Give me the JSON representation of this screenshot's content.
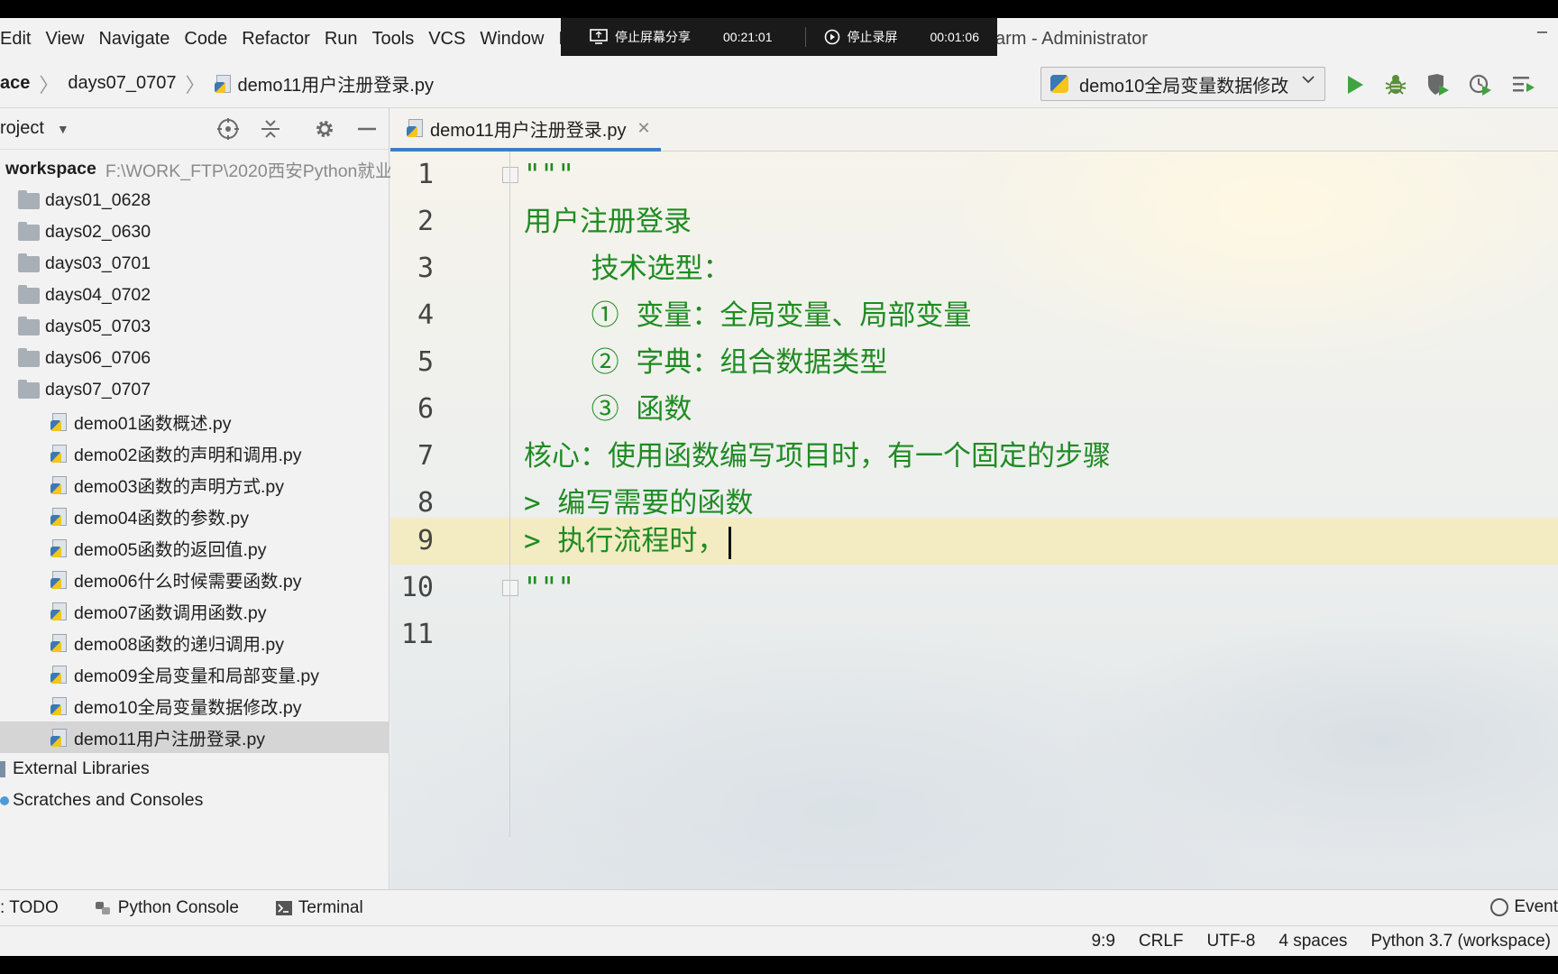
{
  "menu": [
    "Edit",
    "View",
    "Navigate",
    "Code",
    "Refactor",
    "Run",
    "Tools",
    "VCS",
    "Window",
    "H"
  ],
  "window_title": "arm - Administrator",
  "share_overlay": {
    "stop_share_label": "停止屏幕分享",
    "share_time": "00:21:01",
    "stop_record_label": "停止录屏",
    "record_time": "00:01:06"
  },
  "breadcrumb": {
    "root": "ace",
    "folder": "days07_0707",
    "file": "demo11用户注册登录.py"
  },
  "run_config": {
    "name": "demo10全局变量数据修改"
  },
  "project": {
    "title": "roject",
    "root_name": "workspace",
    "root_path": "F:\\WORK_FTP\\2020西安Python就业",
    "folders": [
      "days01_0628",
      "days02_0630",
      "days03_0701",
      "days04_0702",
      "days05_0703",
      "days06_0706",
      "days07_0707"
    ],
    "files": [
      "demo01函数概述.py",
      "demo02函数的声明和调用.py",
      "demo03函数的声明方式.py",
      "demo04函数的参数.py",
      "demo05函数的返回值.py",
      "demo06什么时候需要函数.py",
      "demo07函数调用函数.py",
      "demo08函数的递归调用.py",
      "demo09全局变量和局部变量.py",
      "demo10全局变量数据修改.py",
      "demo11用户注册登录.py"
    ],
    "external_libraries": "External Libraries",
    "scratches": "Scratches and Consoles"
  },
  "editor": {
    "tab_label": "demo11用户注册登录.py",
    "line_numbers": [
      "1",
      "2",
      "3",
      "4",
      "5",
      "6",
      "7",
      "8",
      "9",
      "10",
      "11"
    ],
    "lines": [
      "\"\"\"",
      "用户注册登录",
      "    技术选型：",
      "    ① 变量：全局变量、局部变量",
      "    ② 字典：组合数据类型",
      "    ③ 函数",
      "核心：使用函数编写项目时，有一个固定的步骤",
      "> 编写需要的函数",
      "> 执行流程时，",
      "\"\"\"",
      ""
    ],
    "current_line": 9,
    "text_color": "#1f8b22"
  },
  "bottom_tools": {
    "todo": ": TODO",
    "python_console": "Python Console",
    "terminal": "Terminal",
    "event_log": "Event"
  },
  "status": {
    "position": "9:9",
    "line_sep": "CRLF",
    "encoding": "UTF-8",
    "indent": "4 spaces",
    "interpreter": "Python 3.7 (workspace)"
  }
}
